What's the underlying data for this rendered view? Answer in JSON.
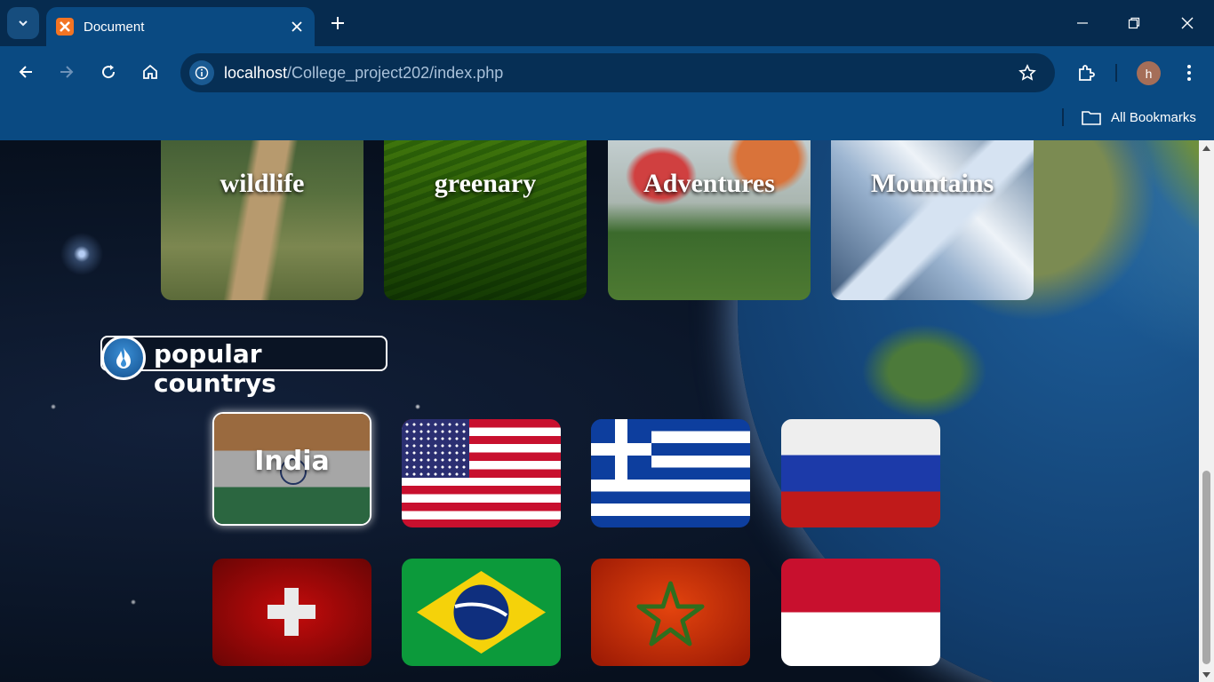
{
  "browser": {
    "tab_title": "Document",
    "url_host": "localhost",
    "url_path": "/College_project202/index.php",
    "profile_initial": "h",
    "bookmarks_label": "All Bookmarks"
  },
  "categories": [
    {
      "label": "wildlife"
    },
    {
      "label": "greenary"
    },
    {
      "label": "Adventures"
    },
    {
      "label": "Mountains"
    }
  ],
  "popular": {
    "heading": "popular countrys",
    "icon": "flame-icon"
  },
  "countries": [
    {
      "name": "India",
      "label": "India",
      "selected": true
    },
    {
      "name": "United States",
      "label": ""
    },
    {
      "name": "Greece",
      "label": ""
    },
    {
      "name": "Russia",
      "label": ""
    },
    {
      "name": "Switzerland",
      "label": ""
    },
    {
      "name": "Brazil",
      "label": ""
    },
    {
      "name": "Morocco",
      "label": ""
    },
    {
      "name": "Indonesia",
      "label": ""
    }
  ],
  "colors": {
    "chrome_dark": "#062b4f",
    "chrome": "#0a4a82",
    "omnibox": "#062f55",
    "accent_orange": "#f37423"
  }
}
